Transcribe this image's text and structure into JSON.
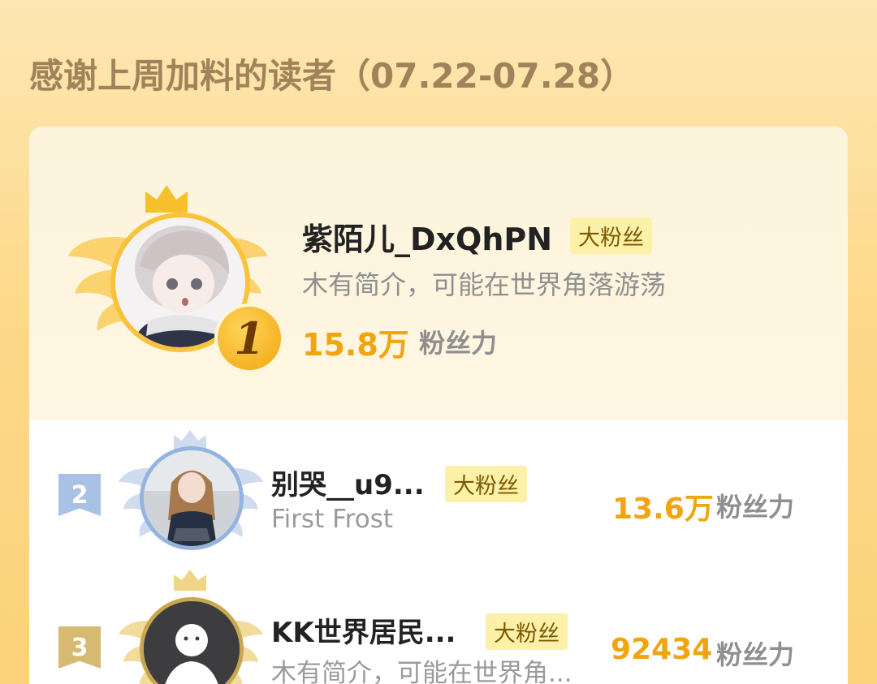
{
  "header": {
    "title": "感谢上周加料的读者（07.22-07.28）"
  },
  "top_reader": {
    "rank": "1",
    "name": "紫陌儿_DxQhPN",
    "badge": "大粉丝",
    "description": "木有简介，可能在世界角落游荡",
    "power_value": "15.8万",
    "power_label": "粉丝力"
  },
  "readers": [
    {
      "rank": "2",
      "name": "别哭__u9...",
      "badge": "大粉丝",
      "description": "First Frost",
      "power_value": "13.6万",
      "power_label": "粉丝力"
    },
    {
      "rank": "3",
      "name": "KK世界居民...",
      "badge": "大粉丝",
      "description": "木有简介，可能在世界角...",
      "power_value": "92434",
      "power_label": "粉丝力"
    }
  ],
  "colors": {
    "accent": "#f1a40e",
    "rank2": "#9cb8de",
    "rank3": "#d2b46a"
  }
}
